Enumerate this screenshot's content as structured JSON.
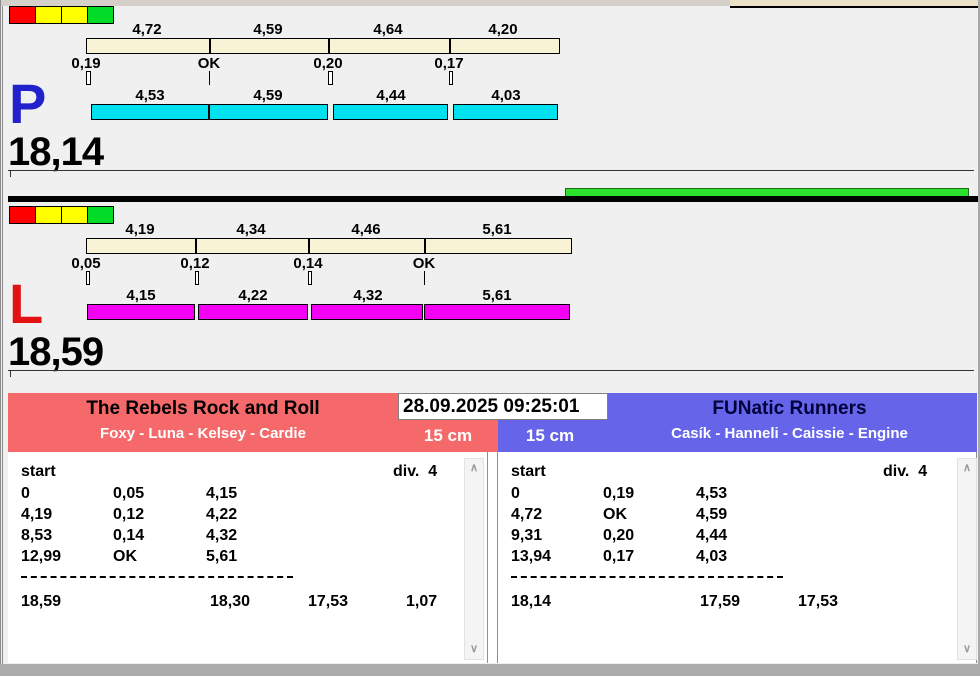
{
  "window": {
    "top_strip_left_color": "#D5D1CA",
    "top_strip_right_color": "#EBE0C8",
    "background": "#F0F0F0",
    "bottom_strip_color": "#ACACAC"
  },
  "status_squares": [
    "#FF0000",
    "#FFFF00",
    "#FFFF00",
    "#00DC28"
  ],
  "lanes": [
    {
      "letter": "P",
      "letter_color": "#2222CC",
      "bar_color": "#00E1F0",
      "top_bar_color": "#F8F3D4",
      "total": "18,14",
      "top_segments": [
        "4,72",
        "4,59",
        "4,64",
        "4,20"
      ],
      "takeovers": [
        "0,19",
        "OK",
        "0,20",
        "0,17"
      ],
      "bottom_segments": [
        "4,53",
        "4,59",
        "4,44",
        "4,03"
      ]
    },
    {
      "letter": "L",
      "letter_color": "#E31212",
      "bar_color": "#F200F2",
      "top_bar_color": "#F8F3D4",
      "total": "18,59",
      "top_segments": [
        "4,19",
        "4,34",
        "4,46",
        "5,61"
      ],
      "takeovers": [
        "0,05",
        "0,12",
        "0,14",
        "OK"
      ],
      "bottom_segments": [
        "4,15",
        "4,22",
        "4,32",
        "5,61"
      ]
    }
  ],
  "progress_bar": {
    "color": "#2EE02E"
  },
  "datetime": "28.09.2025 09:25:01",
  "panels": [
    {
      "title": "The Rebels Rock and Roll",
      "subtitle": "Foxy - Luna - Kelsey - Cardie",
      "distance": "15 cm",
      "header_bg": "#F5696B",
      "title_color": "#000000",
      "start_label": "start",
      "div_label": "div.  4",
      "rows": [
        [
          "0",
          "0,05",
          "4,15"
        ],
        [
          "4,19",
          "0,12",
          "4,22"
        ],
        [
          "8,53",
          "0,14",
          "4,32"
        ],
        [
          "12,99",
          "OK",
          "5,61"
        ]
      ],
      "totals": [
        "18,59",
        "18,30",
        "17,53",
        "1,07"
      ]
    },
    {
      "title": "FUNatic Runners",
      "subtitle": "Casík - Hanneli - Caissie - Engine",
      "distance": "15 cm",
      "header_bg": "#6665EA",
      "title_color": "#00003C",
      "start_label": "start",
      "div_label": "div.  4",
      "rows": [
        [
          "0",
          "0,19",
          "4,53"
        ],
        [
          "4,72",
          "OK",
          "4,59"
        ],
        [
          "9,31",
          "0,20",
          "4,44"
        ],
        [
          "13,94",
          "0,17",
          "4,03"
        ]
      ],
      "totals": [
        "18,14",
        "17,59",
        "17,53",
        ""
      ]
    }
  ]
}
